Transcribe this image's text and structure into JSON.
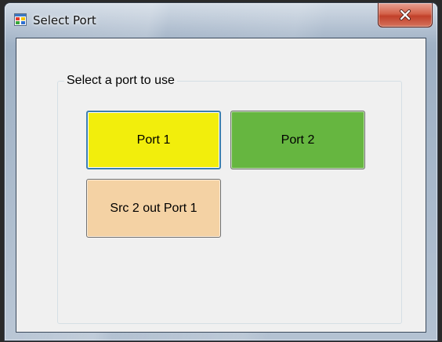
{
  "window": {
    "title": "Select Port",
    "close_glyph": "x"
  },
  "icons": {
    "app": "application-icon",
    "close": "close-icon"
  },
  "group": {
    "label": "Select a port to use"
  },
  "buttons": [
    {
      "label": "Port 1",
      "color": "#f2ee0c",
      "focused": true
    },
    {
      "label": "Port 2",
      "color": "#66b640",
      "focused": false
    },
    {
      "label": "Src 2 out Port 1",
      "color": "#f4d2a4",
      "focused": false
    }
  ],
  "colors": {
    "client_background": "#f0f0f0",
    "focus_border": "#3c7fb1",
    "close_button": "#c1402a"
  }
}
